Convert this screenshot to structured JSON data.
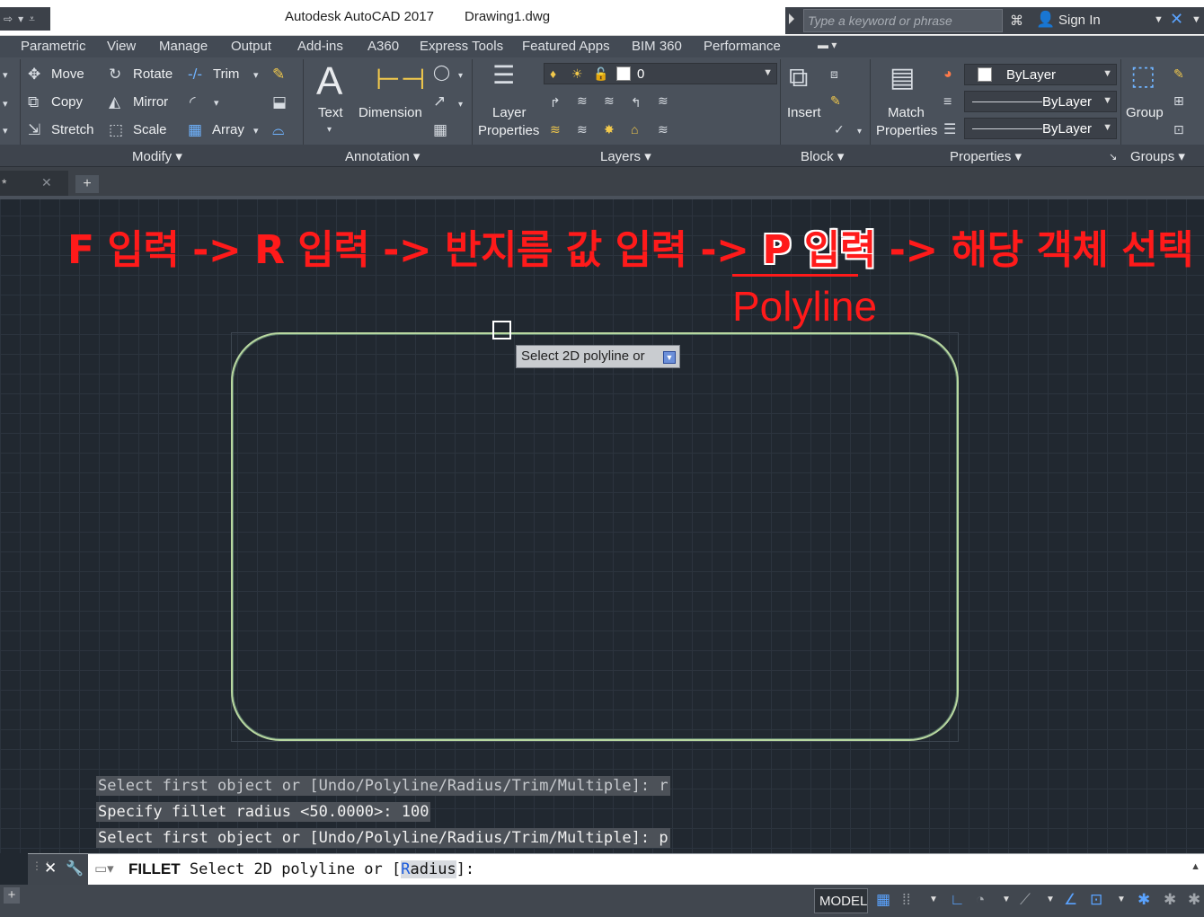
{
  "titlebar": {
    "app_title": "Autodesk AutoCAD 2017",
    "document": "Drawing1.dwg",
    "search_placeholder": "Type a keyword or phrase",
    "sign_in": "Sign In"
  },
  "ribbon_tabs": [
    "Parametric",
    "View",
    "Manage",
    "Output",
    "Add-ins",
    "A360",
    "Express Tools",
    "Featured Apps",
    "BIM 360",
    "Performance"
  ],
  "modify": {
    "title": "Modify",
    "move": "Move",
    "rotate": "Rotate",
    "trim": "Trim",
    "copy": "Copy",
    "mirror": "Mirror",
    "stretch": "Stretch",
    "scale": "Scale",
    "array": "Array"
  },
  "annotation": {
    "title": "Annotation",
    "text": "Text",
    "dimension": "Dimension"
  },
  "layers": {
    "title": "Layers",
    "layer_properties_1": "Layer",
    "layer_properties_2": "Properties",
    "current_layer": "0"
  },
  "block": {
    "title": "Block",
    "insert": "Insert"
  },
  "properties": {
    "title": "Properties",
    "match_1": "Match",
    "match_2": "Properties",
    "color": "ByLayer",
    "linetype": "ByLayer",
    "lineweight": "ByLayer"
  },
  "groups": {
    "title": "Groups",
    "group": "Group"
  },
  "annotation_overlay": {
    "part1": "F 입력 -> R 입력 -> 반지름 값 입력 -> ",
    "highlight": "P 입력",
    "part2": " -> 해당 객체 선택",
    "polyline": "Polyline"
  },
  "tooltip": {
    "text": "Select 2D polyline or"
  },
  "history": [
    "Select first object or [Undo/Polyline/Radius/Trim/Multiple]: r",
    "Specify fillet radius <50.0000>: 100",
    "Select first object or [Undo/Polyline/Radius/Trim/Multiple]: p"
  ],
  "command": {
    "name": "FILLET",
    "prompt": " Select 2D polyline or [",
    "option_key": "R",
    "option_rest": "adius",
    "tail": "]:"
  },
  "status": {
    "model": "MODEL"
  },
  "colors": {
    "annotation_red": "#ff1a1a",
    "shape_outline": "#b9d8a0",
    "canvas": "#212830"
  }
}
